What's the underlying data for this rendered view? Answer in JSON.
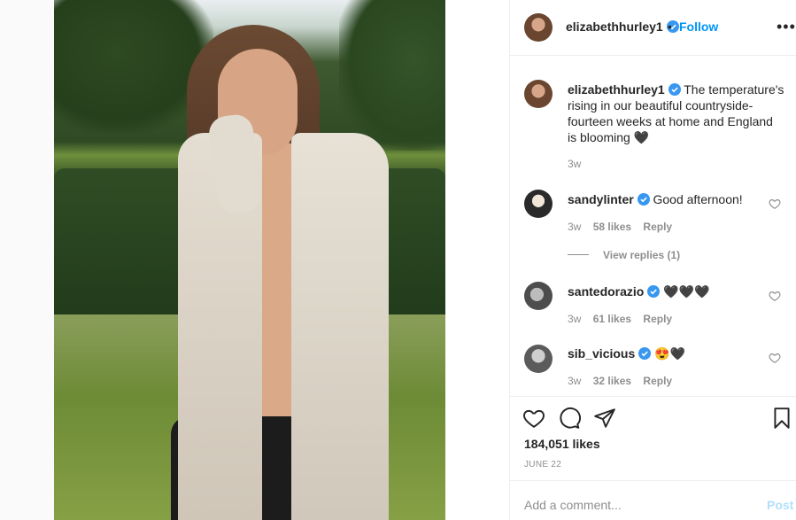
{
  "post": {
    "author": "elizabethhurley1",
    "follow_label": "Follow",
    "dot": "•",
    "more": "•••",
    "caption": "The temperature's rising in our beautiful countryside- fourteen weeks at home and England is blooming 🖤",
    "caption_time": "3w"
  },
  "comments": [
    {
      "user": "sandylinter",
      "text": "Good afternoon!",
      "time": "3w",
      "likes": "58 likes",
      "reply": "Reply"
    },
    {
      "user": "santedorazio",
      "text": "🖤🖤🖤",
      "time": "3w",
      "likes": "61 likes",
      "reply": "Reply"
    },
    {
      "user": "sib_vicious",
      "text": "😍🖤",
      "time": "3w",
      "likes": "32 likes",
      "reply": "Reply"
    }
  ],
  "view_replies": "View replies (1)",
  "likes_count": "184,051 likes",
  "post_date": "JUNE 22",
  "add_comment_placeholder": "Add a comment...",
  "post_button": "Post",
  "colors": {
    "link_blue": "#0095f6",
    "muted": "#8e8e8e",
    "post_disabled": "#b2dffc"
  }
}
